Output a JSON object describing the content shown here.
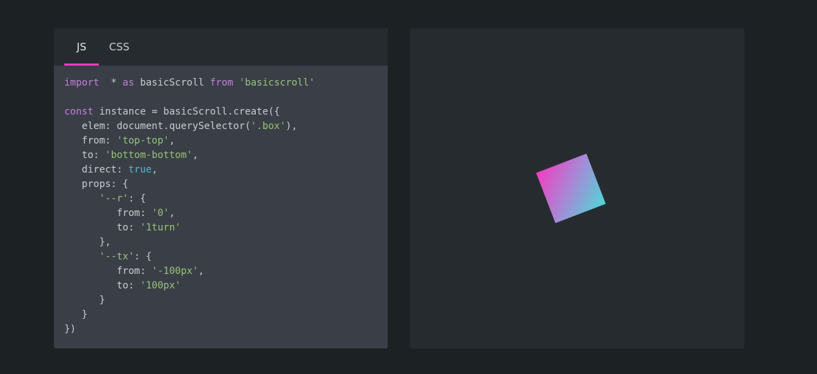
{
  "tabs": [
    {
      "label": "JS",
      "active": true
    },
    {
      "label": "CSS",
      "active": false
    }
  ],
  "colors": {
    "accent": "#e83fbd",
    "keyword": "#c27fd8",
    "string": "#98c379",
    "boolean": "#56b6c2"
  },
  "code_lines": [
    [
      [
        "kw",
        "import"
      ],
      [
        "",
        "  * "
      ],
      [
        "kw",
        "as"
      ],
      [
        "",
        " basicScroll "
      ],
      [
        "kw",
        "from"
      ],
      [
        "",
        " "
      ],
      [
        "str",
        "'basicscroll'"
      ]
    ],
    [],
    [
      [
        "kw",
        "const"
      ],
      [
        "",
        " instance = basicScroll.create({"
      ]
    ],
    [
      [
        "",
        "   elem: document.querySelector("
      ],
      [
        "str",
        "'.box'"
      ],
      [
        "",
        "),"
      ]
    ],
    [
      [
        "",
        "   from: "
      ],
      [
        "str",
        "'top-top'"
      ],
      [
        "",
        ","
      ]
    ],
    [
      [
        "",
        "   to: "
      ],
      [
        "str",
        "'bottom-bottom'"
      ],
      [
        "",
        ","
      ]
    ],
    [
      [
        "",
        "   direct: "
      ],
      [
        "bool",
        "true"
      ],
      [
        "",
        ","
      ]
    ],
    [
      [
        "",
        "   props: {"
      ]
    ],
    [
      [
        "",
        "      "
      ],
      [
        "str",
        "'--r'"
      ],
      [
        "",
        ": {"
      ]
    ],
    [
      [
        "",
        "         from: "
      ],
      [
        "str",
        "'0'"
      ],
      [
        "",
        ","
      ]
    ],
    [
      [
        "",
        "         to: "
      ],
      [
        "str",
        "'1turn'"
      ]
    ],
    [
      [
        "",
        "      },"
      ]
    ],
    [
      [
        "",
        "      "
      ],
      [
        "str",
        "'--tx'"
      ],
      [
        "",
        ": {"
      ]
    ],
    [
      [
        "",
        "         from: "
      ],
      [
        "str",
        "'-100px'"
      ],
      [
        "",
        ","
      ]
    ],
    [
      [
        "",
        "         to: "
      ],
      [
        "str",
        "'100px'"
      ]
    ],
    [
      [
        "",
        "      }"
      ]
    ],
    [
      [
        "",
        "   }"
      ]
    ],
    [
      [
        "",
        "})"
      ]
    ]
  ]
}
